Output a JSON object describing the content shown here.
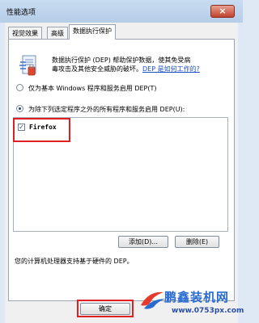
{
  "window": {
    "title": "性能选项",
    "close_glyph": "×"
  },
  "tabs": [
    {
      "label": "视觉效果",
      "active": false
    },
    {
      "label": "高级",
      "active": false
    },
    {
      "label": "数据执行保护",
      "active": true
    }
  ],
  "dep": {
    "icon": "dep-shield-document-icon",
    "description_line1": "数据执行保护 (DEP) 帮助保护数据，使其免受病",
    "description_line2": "毒攻击及其他安全威胁的破坏。",
    "link_text": "DEP 是如何工作的?",
    "option_essential": "仅为基本 Windows 程序和服务启用 DEP(T)",
    "option_all_except": "为除下列选定程序之外的所有程序和服务启用 DEP(U):",
    "selected_option": "all_except",
    "programs": [
      {
        "name": "Firefox",
        "checked": true
      }
    ],
    "add_button": "添加(D)...",
    "remove_button": "删除(E)",
    "hardware_support_text": "您的计算机处理器支持基于硬件的 DEP。"
  },
  "footer": {
    "ok_button": "确定"
  },
  "watermark": {
    "name": "鹏鑫装机网",
    "url": "www.0753px.com"
  },
  "colors": {
    "highlight_box": "#e02020",
    "link": "#1a4fc4",
    "watermark": "#2a6bd1"
  }
}
